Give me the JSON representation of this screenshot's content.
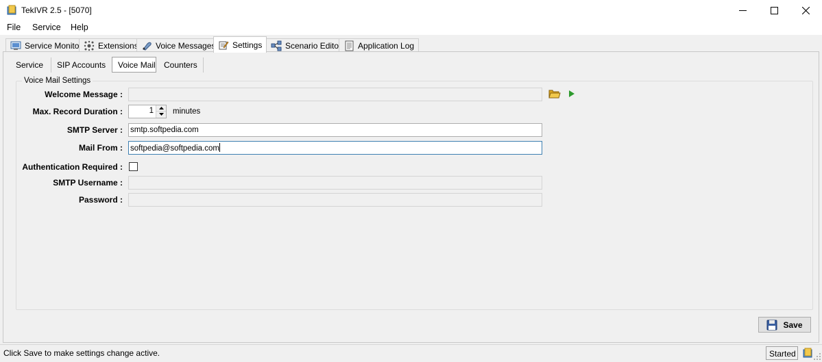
{
  "window": {
    "title": "TekIVR 2.5 - [5070]"
  },
  "menu": [
    "File",
    "Service",
    "Help"
  ],
  "main_tabs": [
    {
      "label": "Service Monitor",
      "icon": "monitor-icon"
    },
    {
      "label": "Extensions",
      "icon": "extensions-icon"
    },
    {
      "label": "Voice Messages",
      "icon": "voice-messages-icon"
    },
    {
      "label": "Settings",
      "icon": "settings-icon",
      "active": true
    },
    {
      "label": "Scenario Editor",
      "icon": "scenario-editor-icon"
    },
    {
      "label": "Application Log",
      "icon": "application-log-icon"
    }
  ],
  "sub_tabs": [
    {
      "label": "Service"
    },
    {
      "label": "SIP Accounts"
    },
    {
      "label": "Voice Mail",
      "active": true
    },
    {
      "label": "Counters"
    }
  ],
  "voice_mail": {
    "group_title": "Voice Mail Settings",
    "welcome_message": {
      "label": "Welcome Message :",
      "value": ""
    },
    "max_record_duration": {
      "label": "Max. Record Duration :",
      "value": "1",
      "unit": "minutes"
    },
    "smtp_server": {
      "label": "SMTP Server :",
      "value": "smtp.softpedia.com"
    },
    "mail_from": {
      "label": "Mail From :",
      "value": "softpedia@softpedia.com"
    },
    "auth_required": {
      "label": "Authentication Required :",
      "checked": false
    },
    "smtp_username": {
      "label": "SMTP Username :",
      "value": ""
    },
    "password": {
      "label": "Password :",
      "value": ""
    }
  },
  "save_button": {
    "label": "Save"
  },
  "status": {
    "message": "Click Save to make settings change active.",
    "state": "Started"
  },
  "colors": {
    "accent_focus": "#3c7fb1",
    "play_green": "#2e9a2e",
    "folder_yellow": "#e6b422"
  }
}
